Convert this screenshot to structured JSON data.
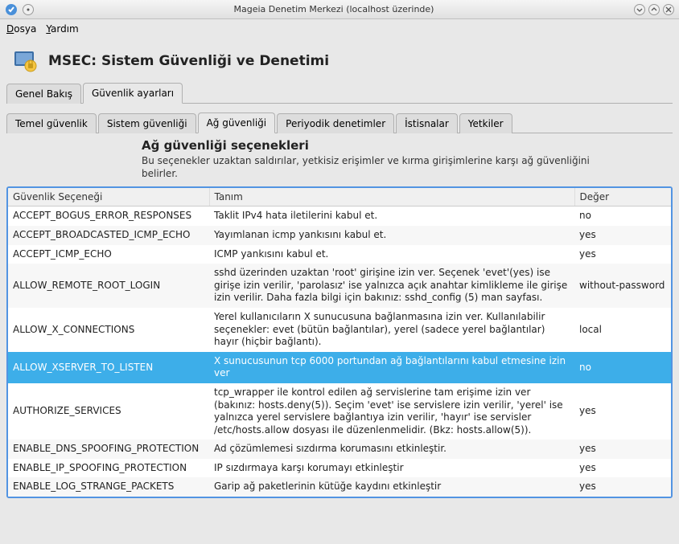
{
  "window": {
    "title": "Mageia Denetim Merkezi  (localhost üzerinde)"
  },
  "menu": {
    "file": "Dosya",
    "help": "Yardım"
  },
  "header": {
    "title": "MSEC: Sistem Güvenliği ve Denetimi"
  },
  "outer_tabs": [
    {
      "label": "Genel Bakış",
      "active": false
    },
    {
      "label": "Güvenlik ayarları",
      "active": true
    }
  ],
  "inner_tabs": [
    {
      "label": "Temel güvenlik",
      "active": false
    },
    {
      "label": "Sistem güvenliği",
      "active": false
    },
    {
      "label": "Ağ güvenliği",
      "active": true
    },
    {
      "label": "Periyodik denetimler",
      "active": false
    },
    {
      "label": "İstisnalar",
      "active": false
    },
    {
      "label": "Yetkiler",
      "active": false
    }
  ],
  "section": {
    "title": "Ağ güvenliği seçenekleri",
    "subtitle": "Bu seçenekler uzaktan saldırılar, yetkisiz erişimler ve kırma girişimlerine karşı ağ güvenliğini belirler."
  },
  "columns": {
    "opt": "Güvenlik Seçeneği",
    "desc": "Tanım",
    "val": "Değer"
  },
  "rows": [
    {
      "opt": "ACCEPT_BOGUS_ERROR_RESPONSES",
      "desc": "Taklit IPv4 hata iletilerini kabul et.",
      "val": "no",
      "selected": false
    },
    {
      "opt": "ACCEPT_BROADCASTED_ICMP_ECHO",
      "desc": "Yayımlanan icmp yankısını kabul et.",
      "val": "yes",
      "selected": false
    },
    {
      "opt": "ACCEPT_ICMP_ECHO",
      "desc": "ICMP yankısını kabul et.",
      "val": "yes",
      "selected": false
    },
    {
      "opt": "ALLOW_REMOTE_ROOT_LOGIN",
      "desc": "sshd üzerinden uzaktan 'root' girişine izin ver. Seçenek 'evet'(yes) ise girişe izin verilir, 'parolasız' ise yalnızca açık anahtar kimlikleme ile girişe izin verilir. Daha fazla bilgi için bakınız: sshd_config (5) man sayfası.",
      "val": "without-password",
      "selected": false
    },
    {
      "opt": "ALLOW_X_CONNECTIONS",
      "desc": "Yerel kullanıcıların X sunucusuna bağlanmasına izin ver. Kullanılabilir seçenekler: evet (bütün bağlantılar), yerel (sadece yerel bağlantılar) hayır (hiçbir bağlantı).",
      "val": "local",
      "selected": false
    },
    {
      "opt": "ALLOW_XSERVER_TO_LISTEN",
      "desc": "X sunucusunun tcp 6000 portundan ağ bağlantılarını kabul etmesine izin ver",
      "val": "no",
      "selected": true
    },
    {
      "opt": "AUTHORIZE_SERVICES",
      "desc": "tcp_wrapper ile kontrol edilen ağ servislerine tam erişime izin ver (bakınız: hosts.deny(5)). Seçim 'evet' ise servislere izin verilir, 'yerel' ise yalnızca yerel servislere bağlantıya izin verilir, 'hayır' ise servisler /etc/hosts.allow dosyası ile düzenlenmelidir. (Bkz: hosts.allow(5)).",
      "val": "yes",
      "selected": false
    },
    {
      "opt": "ENABLE_DNS_SPOOFING_PROTECTION",
      "desc": "Ad çözümlemesi sızdırma korumasını etkinleştir.",
      "val": "yes",
      "selected": false
    },
    {
      "opt": "ENABLE_IP_SPOOFING_PROTECTION",
      "desc": "IP sızdırmaya karşı korumayı etkinleştir",
      "val": "yes",
      "selected": false
    },
    {
      "opt": "ENABLE_LOG_STRANGE_PACKETS",
      "desc": "Garip ağ paketlerinin kütüğe kaydını etkinleştir",
      "val": "yes",
      "selected": false
    }
  ]
}
